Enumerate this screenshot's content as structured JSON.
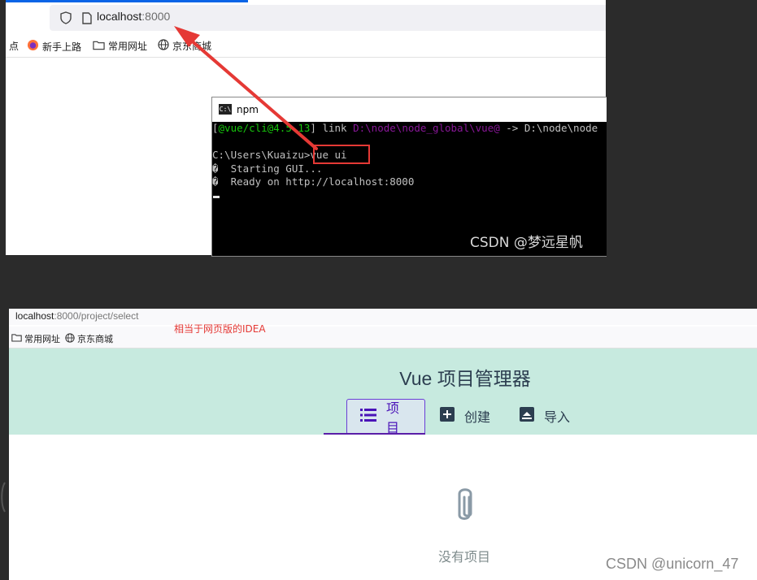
{
  "top_browser": {
    "url_host": "localhost",
    "url_port": ":8000",
    "bookmarks": [
      {
        "label": "点",
        "icon": "partial-text"
      },
      {
        "label": "新手上路",
        "icon": "firefox-icon"
      },
      {
        "label": "常用网址",
        "icon": "folder-icon"
      },
      {
        "label": "京东商城",
        "icon": "globe-icon"
      }
    ]
  },
  "terminal": {
    "title": "npm",
    "lines": [
      {
        "parts": [
          [
            "",
            "["
          ],
          [
            "green",
            "@vue/cli@4.5.13"
          ],
          [
            "",
            "] link "
          ],
          [
            "purple",
            "D:\\node\\node_global\\vue@"
          ],
          [
            "",
            " -> D:\\node\\node"
          ]
        ]
      },
      {
        "parts": [
          [
            "",
            ""
          ]
        ]
      },
      {
        "parts": [
          [
            "",
            "C:\\Users\\Kuaizu>vue ui"
          ]
        ]
      },
      {
        "parts": [
          [
            "",
            "�  Starting GUI..."
          ]
        ]
      },
      {
        "parts": [
          [
            "",
            "�  Ready on http://localhost:8000"
          ]
        ]
      }
    ],
    "watermark": "CSDN @梦远星帆"
  },
  "bottom_browser": {
    "url_host": "localhost",
    "url_rest": ":8000/project/select",
    "bookmarks": [
      {
        "label": "常用网址",
        "icon": "folder-icon"
      },
      {
        "label": "京东商城",
        "icon": "globe-icon"
      }
    ],
    "annotation": "相当于网页版的IDEA"
  },
  "vue_ui": {
    "title": "Vue 项目管理器",
    "tabs": [
      {
        "label": "项目",
        "icon": "list-icon",
        "active": true
      },
      {
        "label": "创建",
        "icon": "plus-box-icon",
        "active": false
      },
      {
        "label": "导入",
        "icon": "import-icon",
        "active": false
      }
    ],
    "empty_text": "没有项目",
    "accent_color": "#4a12b8",
    "header_color": "#c7eadf"
  },
  "watermark_bottom": "CSDN @unicorn_47"
}
